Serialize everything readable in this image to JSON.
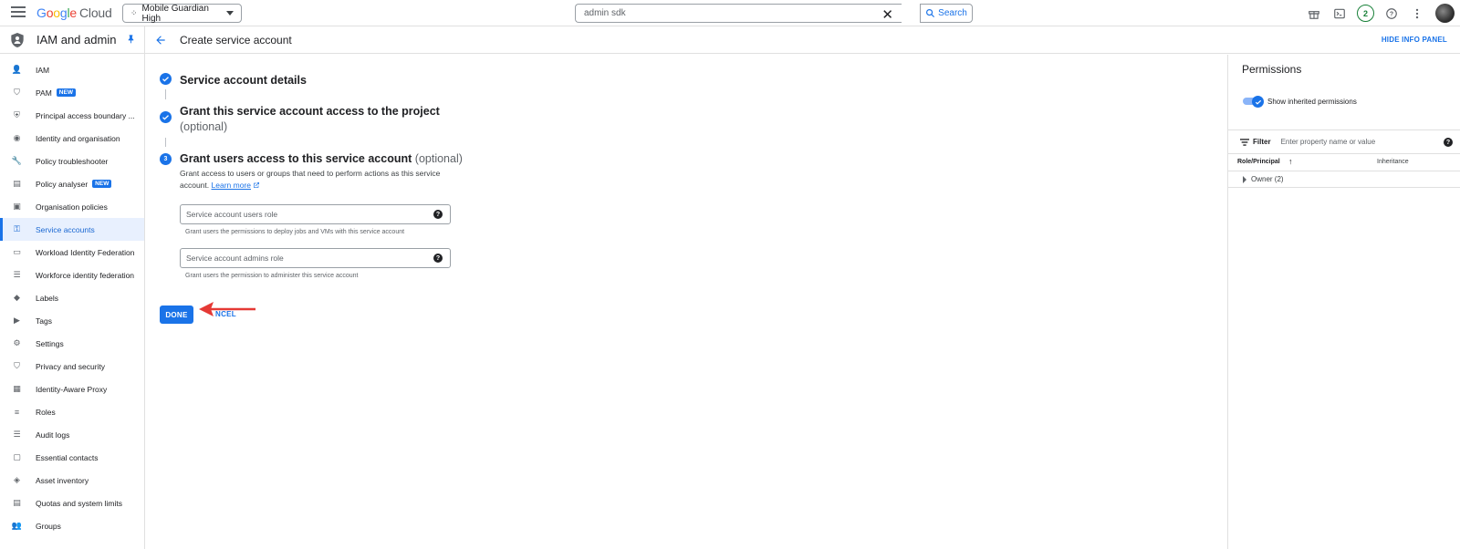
{
  "topbar": {
    "logo_google": "Google",
    "logo_cloud": "Cloud",
    "project": "Mobile Guardian High",
    "search_value": "admin sdk",
    "search_button": "Search",
    "notification_count": "2"
  },
  "sidebar": {
    "title": "IAM and admin",
    "items": [
      {
        "label": "IAM",
        "icon": "person-add-icon"
      },
      {
        "label": "PAM",
        "icon": "shield-icon",
        "badge": "NEW"
      },
      {
        "label": "Principal access boundary ...",
        "icon": "boundary-icon"
      },
      {
        "label": "Identity and organisation",
        "icon": "account-circle-icon"
      },
      {
        "label": "Policy troubleshooter",
        "icon": "wrench-icon"
      },
      {
        "label": "Policy analyser",
        "icon": "document-search-icon",
        "badge": "NEW"
      },
      {
        "label": "Organisation policies",
        "icon": "list-box-icon"
      },
      {
        "label": "Service accounts",
        "icon": "service-account-icon"
      },
      {
        "label": "Workload Identity Federation",
        "icon": "id-card-icon"
      },
      {
        "label": "Workforce identity federation",
        "icon": "list-icon"
      },
      {
        "label": "Labels",
        "icon": "label-icon"
      },
      {
        "label": "Tags",
        "icon": "tag-icon"
      },
      {
        "label": "Settings",
        "icon": "gear-icon"
      },
      {
        "label": "Privacy and security",
        "icon": "shield-lock-icon"
      },
      {
        "label": "Identity-Aware Proxy",
        "icon": "proxy-icon"
      },
      {
        "label": "Roles",
        "icon": "roles-icon"
      },
      {
        "label": "Audit logs",
        "icon": "logs-icon"
      },
      {
        "label": "Essential contacts",
        "icon": "contact-icon"
      },
      {
        "label": "Asset inventory",
        "icon": "inventory-icon"
      },
      {
        "label": "Quotas and system limits",
        "icon": "quota-icon"
      },
      {
        "label": "Groups",
        "icon": "groups-icon"
      }
    ]
  },
  "page": {
    "title": "Create service account",
    "hide_info": "HIDE INFO PANEL"
  },
  "steps": {
    "step1_title": "Service account details",
    "step2_title": "Grant this service account access to the project",
    "step2_optional": "(optional)",
    "step3_number": "3",
    "step3_title": "Grant users access to this service account",
    "step3_optional": "(optional)",
    "step3_desc": "Grant access to users or groups that need to perform actions as this service account.",
    "learn_more": "Learn more",
    "users_role_placeholder": "Service account users role",
    "users_role_hint": "Grant users the permissions to deploy jobs and VMs with this service account",
    "admins_role_placeholder": "Service account admins role",
    "admins_role_hint": "Grant users the permission to administer this service account",
    "done": "DONE",
    "cancel": "NCEL"
  },
  "info_panel": {
    "title": "Permissions",
    "toggle_label": "Show inherited permissions",
    "filter_label": "Filter",
    "filter_placeholder": "Enter property name or value",
    "col_role": "Role/Principal",
    "col_inheritance": "Inheritance",
    "row_owner": "Owner (2)"
  },
  "colors": {
    "accent": "#1a73e8",
    "active_bg": "#e8f0fe",
    "annotation_arrow": "#e53935"
  }
}
